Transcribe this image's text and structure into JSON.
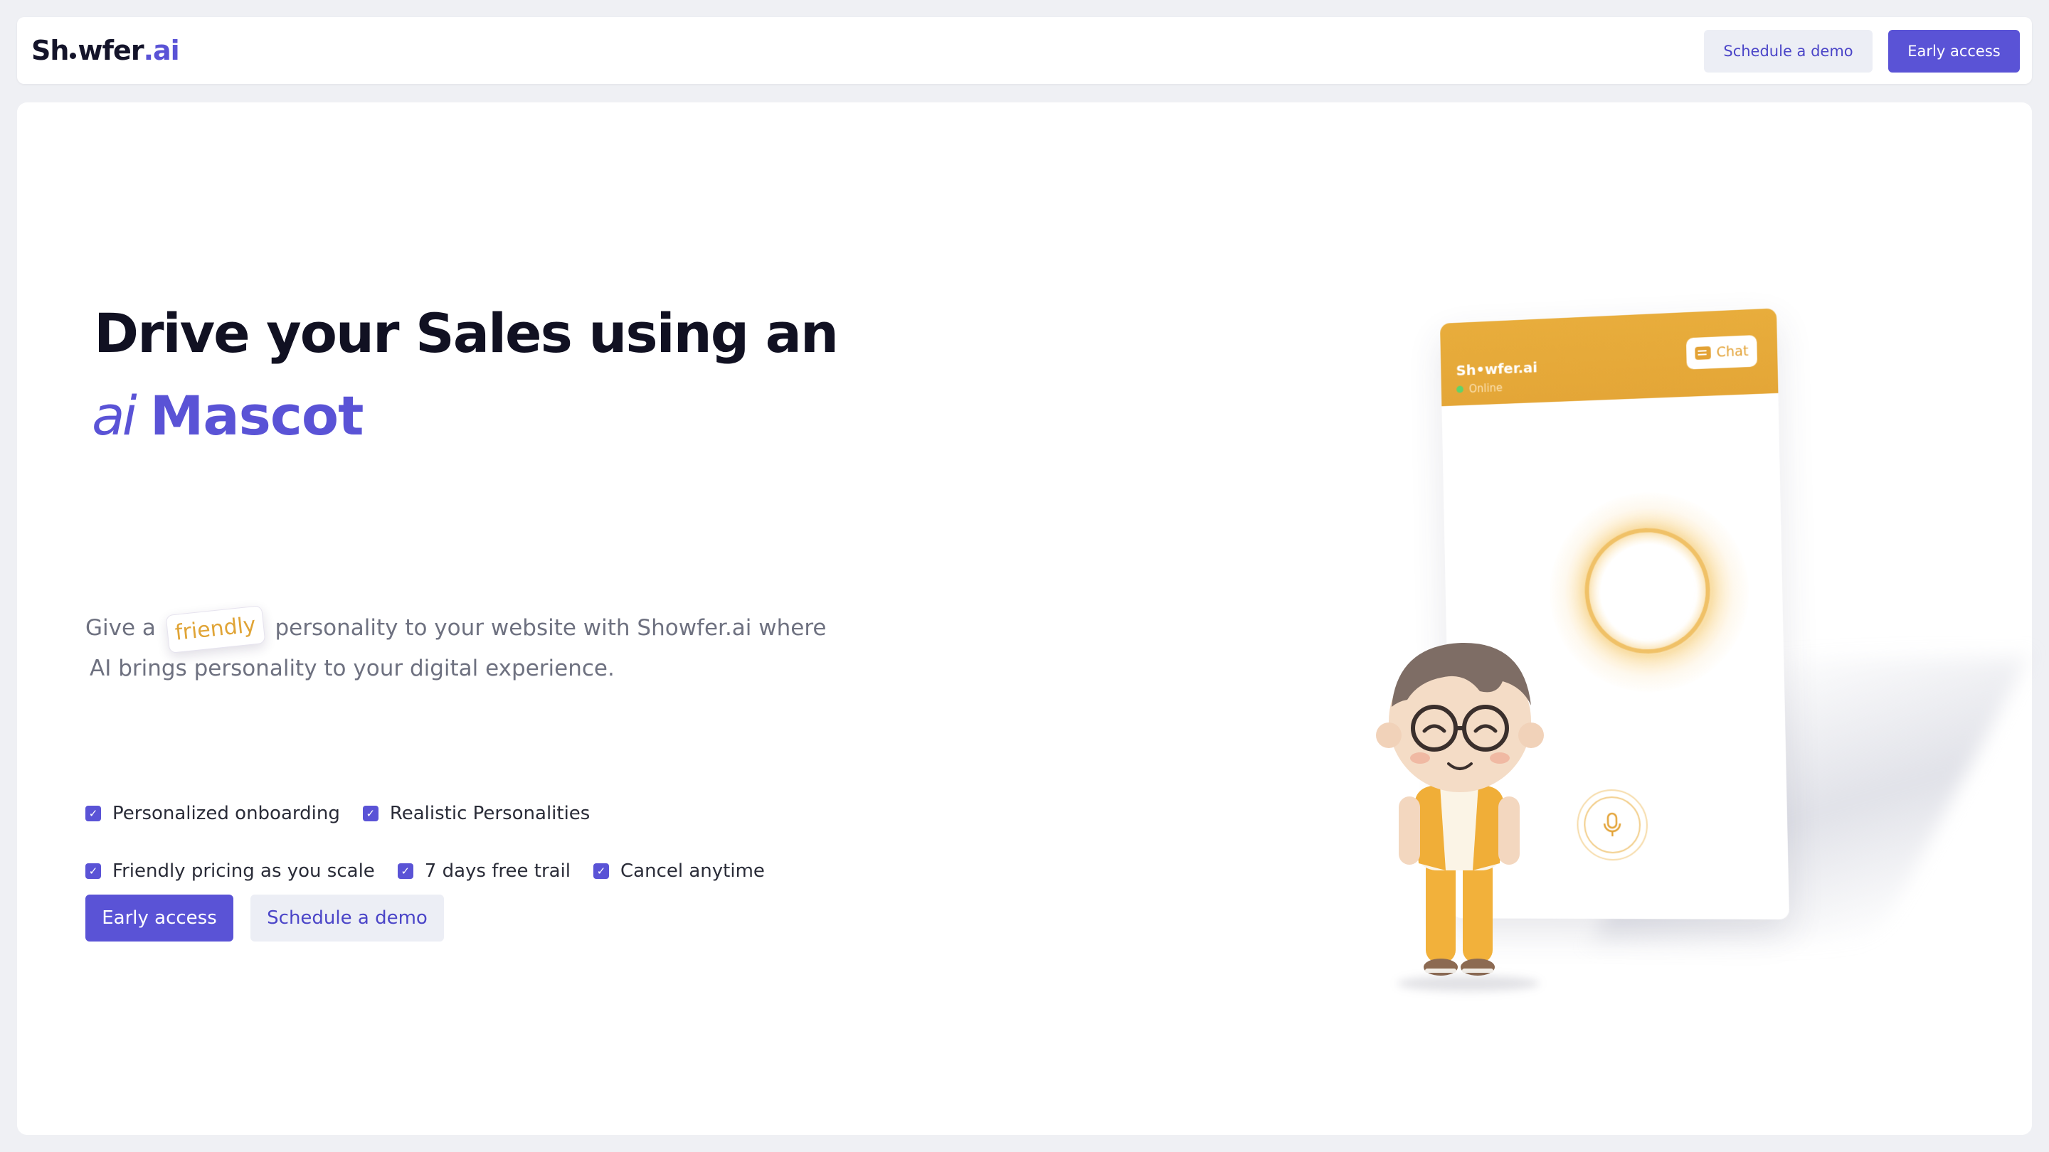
{
  "nav": {
    "logo": {
      "part1": "Sh",
      "part2": "wfer",
      "part3": ".ai"
    },
    "schedule_demo": "Schedule a demo",
    "early_access": "Early access"
  },
  "hero": {
    "headline": "Drive your Sales using an",
    "headline_ai": "ai",
    "headline_mascot": "Mascot",
    "subtext_before": "Give a",
    "subtext_highlight": "friendly",
    "subtext_after": "personality to your website with Showfer.ai where",
    "subtext_line2": "AI brings personality to your digital experience.",
    "features_row1": [
      "Personalized onboarding",
      "Realistic Personalities"
    ],
    "features_row2": [
      "Friendly pricing as you scale",
      "7 days free trail",
      "Cancel anytime"
    ],
    "cta_early": "Early access",
    "cta_demo": "Schedule a demo"
  },
  "widget": {
    "brand": "Sh•wfer.ai",
    "status": "Online",
    "chat": "Chat"
  },
  "colors": {
    "accent": "#5a53d6",
    "amber": "#e4a637",
    "text": "#111122",
    "muted": "#6e7180"
  },
  "icons": {
    "feature_check": "checkbox-checked-icon",
    "chat": "chat-bubble-icon",
    "mic": "microphone-icon"
  }
}
